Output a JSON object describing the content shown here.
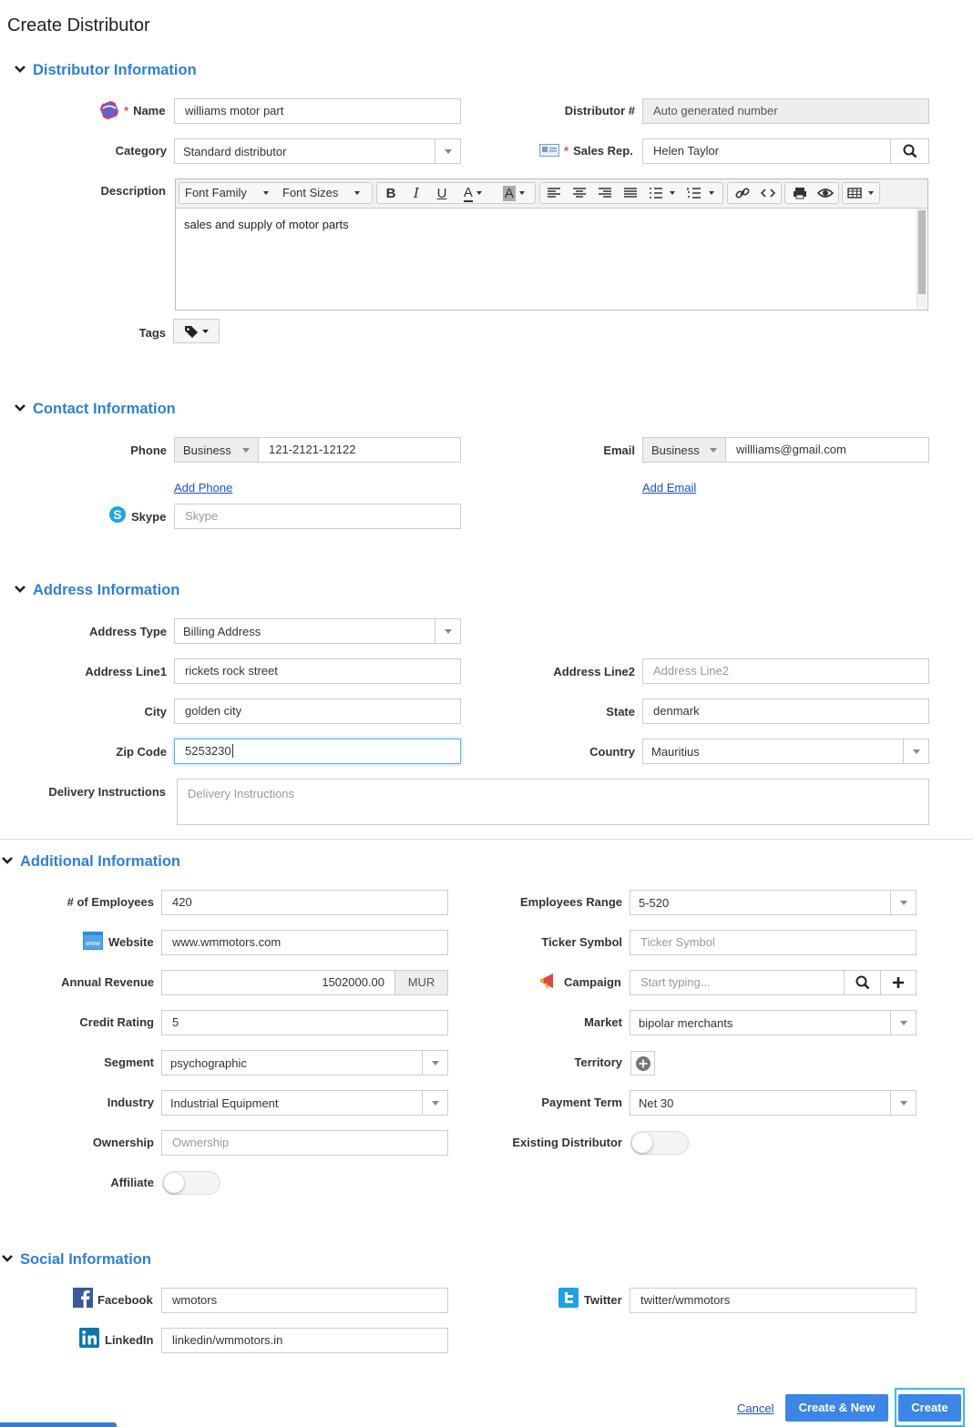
{
  "page": {
    "title": "Create Distributor"
  },
  "sections": {
    "distributor": "Distributor Information",
    "contact": "Contact Information",
    "address": "Address Information",
    "additional": "Additional Information",
    "social": "Social Information"
  },
  "distributor": {
    "name_label": "Name",
    "name_value": "williams motor part",
    "number_label": "Distributor #",
    "number_placeholder": "Auto generated number",
    "category_label": "Category",
    "category_value": "Standard distributor",
    "salesrep_label": "Sales Rep.",
    "salesrep_value": "Helen Taylor",
    "description_label": "Description",
    "description_value": "sales and supply of motor parts",
    "font_family": "Font Family",
    "font_sizes": "Font Sizes",
    "tags_label": "Tags"
  },
  "contact": {
    "phone_label": "Phone",
    "phone_type": "Business",
    "phone_value": "121-2121-12122",
    "email_label": "Email",
    "email_type": "Business",
    "email_value": "willliams@gmail.com",
    "add_phone": "Add Phone",
    "add_email": "Add Email",
    "skype_label": "Skype",
    "skype_placeholder": "Skype"
  },
  "address": {
    "type_label": "Address Type",
    "type_value": "Billing Address",
    "line1_label": "Address Line1",
    "line1_value": "rickets rock street",
    "line2_label": "Address Line2",
    "line2_placeholder": "Address Line2",
    "city_label": "City",
    "city_value": "golden city",
    "state_label": "State",
    "state_value": "denmark",
    "zip_label": "Zip Code",
    "zip_value": "5253230",
    "country_label": "Country",
    "country_value": "Mauritius",
    "delivery_label": "Delivery Instructions",
    "delivery_placeholder": "Delivery Instructions"
  },
  "additional": {
    "employees_label": "# of Employees",
    "employees_value": "420",
    "range_label": "Employees Range",
    "range_value": "5-520",
    "website_label": "Website",
    "website_value": "www.wmmotors.com",
    "ticker_label": "Ticker Symbol",
    "ticker_placeholder": "Ticker Symbol",
    "revenue_label": "Annual Revenue",
    "revenue_value": "1502000.00",
    "revenue_currency": "MUR",
    "campaign_label": "Campaign",
    "campaign_placeholder": "Start typing...",
    "credit_label": "Credit Rating",
    "credit_value": "5",
    "market_label": "Market",
    "market_value": "bipolar merchants",
    "segment_label": "Segment",
    "segment_value": "psychographic",
    "territory_label": "Territory",
    "industry_label": "Industry",
    "industry_value": "Industrial Equipment",
    "payment_label": "Payment Term",
    "payment_value": "Net 30",
    "ownership_label": "Ownership",
    "ownership_placeholder": "Ownership",
    "existing_label": "Existing Distributor",
    "affiliate_label": "Affiliate"
  },
  "social": {
    "facebook_label": "Facebook",
    "facebook_value": "wmotors",
    "twitter_label": "Twitter",
    "twitter_value": "twitter/wmmotors",
    "linkedin_label": "LinkedIn",
    "linkedin_value": "linkedin/wmmotors.in"
  },
  "footer": {
    "cancel": "Cancel",
    "create_new": "Create & New",
    "create": "Create"
  },
  "colors": {
    "accent": "#2e7fd6",
    "primary_button": "#3b86e6",
    "required": "#d9534f"
  }
}
